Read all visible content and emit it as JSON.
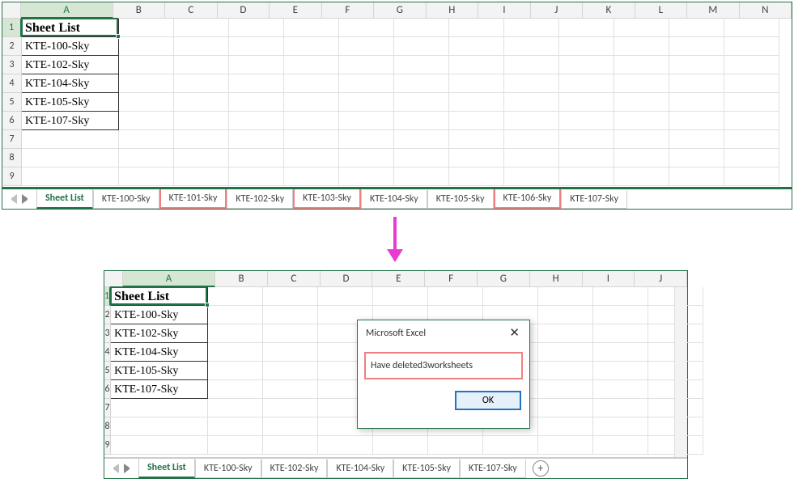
{
  "top": {
    "columns": [
      "A",
      "B",
      "C",
      "D",
      "E",
      "F",
      "G",
      "H",
      "I",
      "J",
      "K",
      "L",
      "M",
      "N"
    ],
    "rows": [
      "1",
      "2",
      "3",
      "4",
      "5",
      "6",
      "7",
      "8",
      "9"
    ],
    "header_cell": "Sheet List",
    "data": [
      "KTE-100-Sky",
      "KTE-102-Sky",
      "KTE-104-Sky",
      "KTE-105-Sky",
      "KTE-107-Sky"
    ],
    "tabs": [
      {
        "label": "Sheet List",
        "active": true,
        "hl": false
      },
      {
        "label": "KTE-100-Sky",
        "active": false,
        "hl": false
      },
      {
        "label": "KTE-101-Sky",
        "active": false,
        "hl": true
      },
      {
        "label": "KTE-102-Sky",
        "active": false,
        "hl": false
      },
      {
        "label": "KTE-103-Sky",
        "active": false,
        "hl": true
      },
      {
        "label": "KTE-104-Sky",
        "active": false,
        "hl": false
      },
      {
        "label": "KTE-105-Sky",
        "active": false,
        "hl": false
      },
      {
        "label": "KTE-106-Sky",
        "active": false,
        "hl": true
      },
      {
        "label": "KTE-107-Sky",
        "active": false,
        "hl": false
      }
    ]
  },
  "bottom": {
    "columns": [
      "A",
      "B",
      "C",
      "D",
      "E",
      "F",
      "G",
      "H",
      "I",
      "J"
    ],
    "rows": [
      "1",
      "2",
      "3",
      "4",
      "5",
      "6",
      "7",
      "8",
      "9"
    ],
    "header_cell": "Sheet List",
    "data": [
      "KTE-100-Sky",
      "KTE-102-Sky",
      "KTE-104-Sky",
      "KTE-105-Sky",
      "KTE-107-Sky"
    ],
    "tabs": [
      {
        "label": "Sheet List",
        "active": true,
        "hl": false
      },
      {
        "label": "KTE-100-Sky",
        "active": false,
        "hl": false
      },
      {
        "label": "KTE-102-Sky",
        "active": false,
        "hl": false
      },
      {
        "label": "KTE-104-Sky",
        "active": false,
        "hl": false
      },
      {
        "label": "KTE-105-Sky",
        "active": false,
        "hl": false
      },
      {
        "label": "KTE-107-Sky",
        "active": false,
        "hl": false
      }
    ]
  },
  "dialog": {
    "title": "Microsoft Excel",
    "message": "Have deleted3worksheets",
    "ok": "OK"
  }
}
